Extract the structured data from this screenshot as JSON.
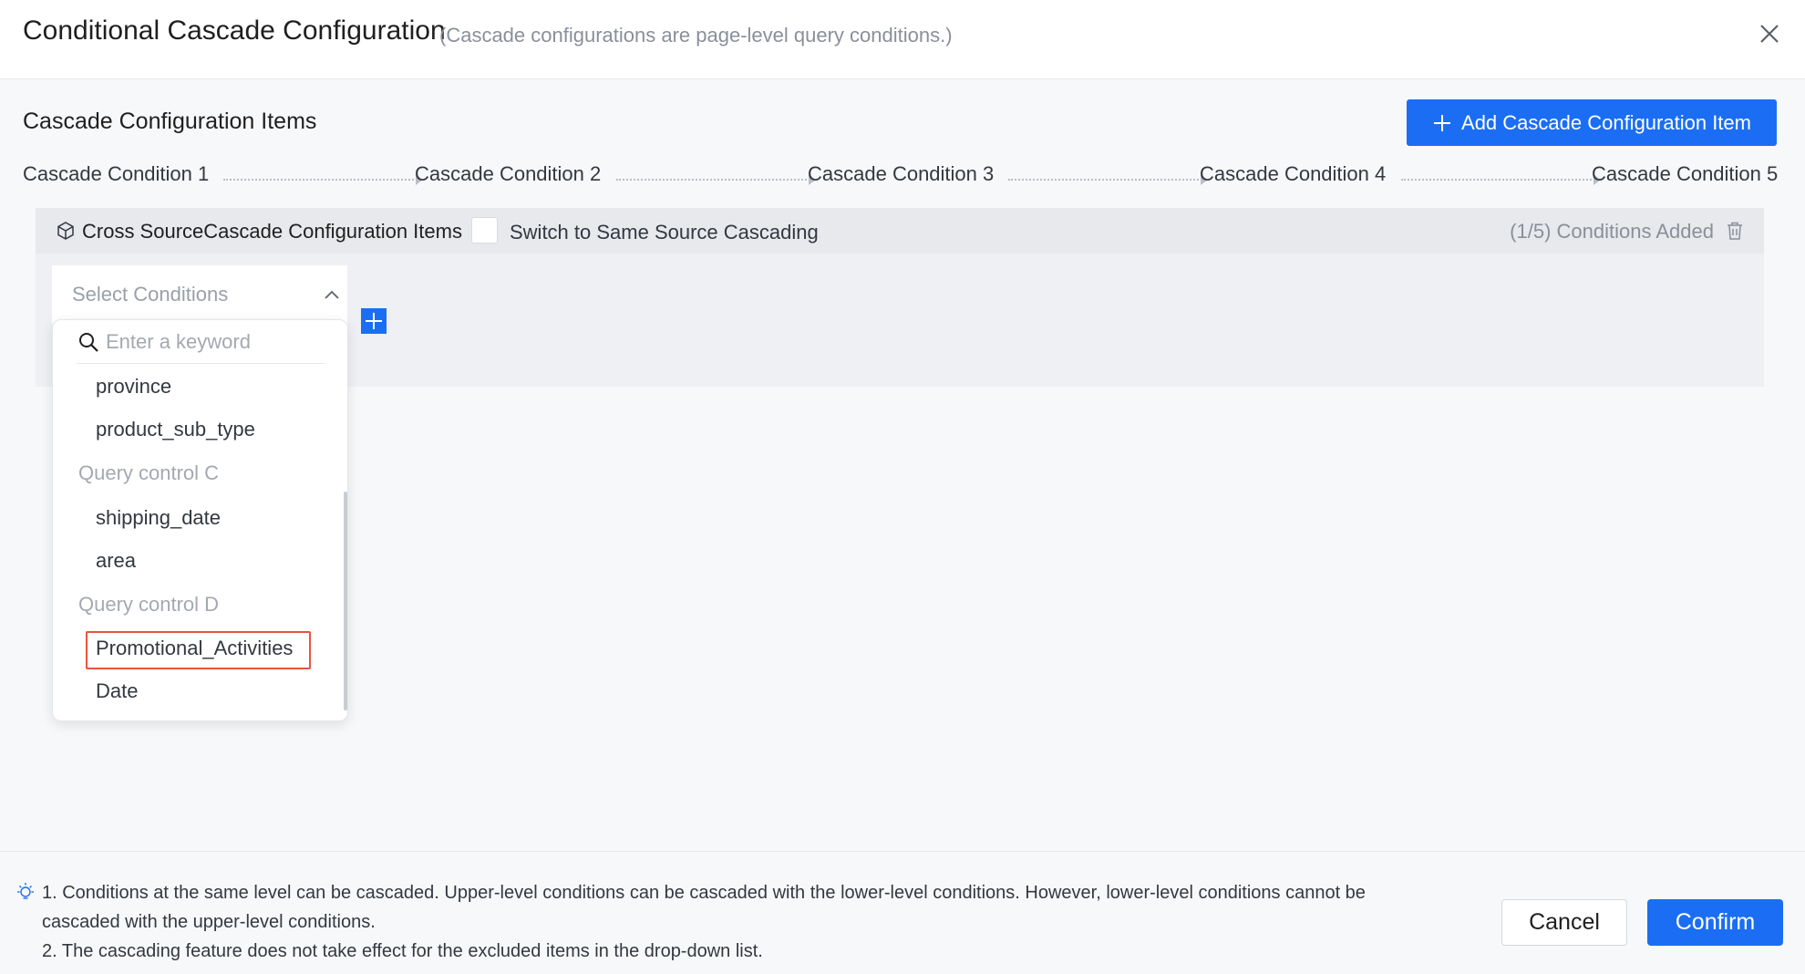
{
  "dialog": {
    "title": "Conditional Cascade Configuration",
    "subtitle": "(Cascade configurations are page-level query conditions.)",
    "close_icon": "close-icon"
  },
  "section": {
    "title": "Cascade Configuration Items",
    "add_button_label": "Add Cascade Configuration Item"
  },
  "steps": [
    "Cascade Condition 1",
    "Cascade Condition 2",
    "Cascade Condition 3",
    "Cascade Condition 4",
    "Cascade Condition 5"
  ],
  "config": {
    "label": "Cross SourceCascade Configuration Items",
    "switch_label": "Switch to Same Source Cascading",
    "switch_checked": false,
    "conditions_count": "(1/5) Conditions Added",
    "select_placeholder": "Select Conditions"
  },
  "dropdown": {
    "search_placeholder": "Enter a keyword",
    "items": [
      {
        "type": "option",
        "label": "province"
      },
      {
        "type": "option",
        "label": "product_sub_type"
      },
      {
        "type": "group",
        "label": "Query control C"
      },
      {
        "type": "option",
        "label": "shipping_date"
      },
      {
        "type": "option",
        "label": "area"
      },
      {
        "type": "group",
        "label": "Query control D"
      },
      {
        "type": "option",
        "label": "Promotional_Activities",
        "highlighted": true
      },
      {
        "type": "option",
        "label": "Date"
      }
    ]
  },
  "footer": {
    "notes": [
      "1. Conditions at the same level can be cascaded. Upper-level conditions can be cascaded with the lower-level conditions. However, lower-level conditions cannot be",
      "cascaded with the upper-level conditions.",
      "2. The cascading feature does not take effect for the excluded items in the drop-down list."
    ],
    "cancel_label": "Cancel",
    "confirm_label": "Confirm"
  },
  "colors": {
    "primary": "#1b6ef3",
    "highlight": "#e8543e"
  }
}
